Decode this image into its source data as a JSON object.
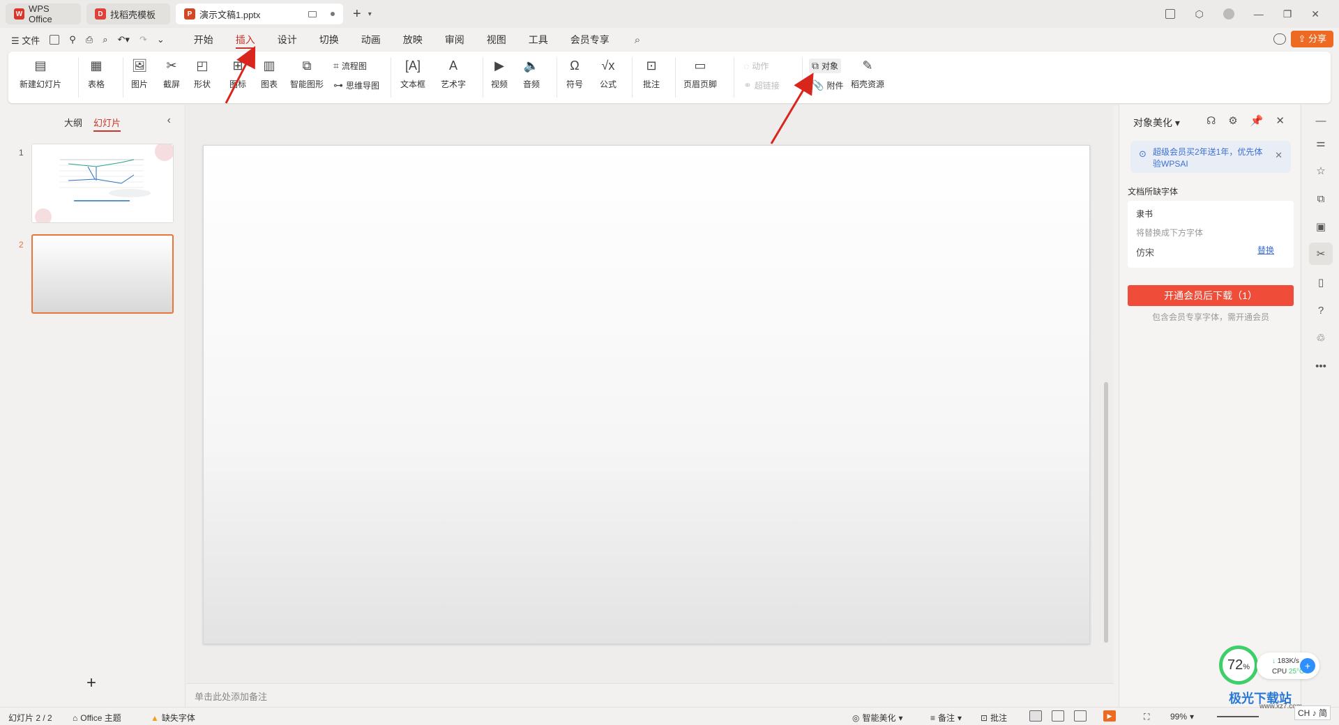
{
  "titlebar": {
    "tabs": [
      {
        "label": "WPS Office",
        "logo": "W",
        "color": "#d9362b"
      },
      {
        "label": "找稻壳模板",
        "logo": "D",
        "color": "#e04035"
      },
      {
        "label": "演示文稿1.pptx",
        "logo": "P",
        "color": "#d24726"
      }
    ],
    "new_tab_icon": "plus-icon"
  },
  "menubar": {
    "file_label": "文件",
    "tabs": [
      "开始",
      "插入",
      "设计",
      "切换",
      "动画",
      "放映",
      "审阅",
      "视图",
      "工具",
      "会员专享"
    ],
    "active_tab": "插入",
    "share_label": "分享"
  },
  "ribbon": {
    "new_slide": "新建幻灯片",
    "table": "表格",
    "picture": "图片",
    "screenshot": "截屏",
    "shape": "形状",
    "icon": "图标",
    "chart": "图表",
    "smartart": "智能图形",
    "flowchart": "流程图",
    "mindmap": "思维导图",
    "textbox": "文本框",
    "wordart": "艺术字",
    "video": "视频",
    "audio": "音频",
    "symbol": "符号",
    "formula": "公式",
    "comment": "批注",
    "header_footer": "页眉页脚",
    "action": "动作",
    "hyperlink": "超链接",
    "object": "对象",
    "attachment": "附件",
    "docer_resources": "稻壳资源"
  },
  "left_panel": {
    "tabs": [
      "大纲",
      "幻灯片"
    ],
    "active_tab": "幻灯片",
    "slides": [
      {
        "number": "1"
      },
      {
        "number": "2",
        "selected": true
      }
    ]
  },
  "notes_placeholder": "单击此处添加备注",
  "task_pane": {
    "title": "对象美化",
    "promo": "超级会员买2年送1年，优先体验WPSAI",
    "section_label": "文档所缺字体",
    "missing_font": "隶书",
    "replace_hint": "将替换成下方字体",
    "replacement_font": "仿宋",
    "replace_link": "替换",
    "download_button": "开通会员后下载（1）",
    "footnote": "包含会员专享字体，需开通会员"
  },
  "statusbar": {
    "slide_counter": "幻灯片 2 / 2",
    "theme": "Office 主题",
    "missing_font": "缺失字体",
    "smart_beautify": "智能美化",
    "notes": "备注",
    "comments": "批注",
    "zoom": "99%"
  },
  "perf_widget": {
    "percent": "72",
    "percent_unit": "%",
    "net_speed": "183K/s",
    "cpu_label": "CPU",
    "cpu_temp": "25°C"
  },
  "watermark": {
    "brand": "极光下载站",
    "url": "www.xz7.com"
  },
  "ime_indicator": "CH ♪ 简",
  "colors": {
    "accent_red": "#c7352b",
    "share_orange": "#ee6a23",
    "download_red": "#ef4c3a",
    "link_blue": "#3b6fd4",
    "annotation_arrow": "#d9261c"
  }
}
